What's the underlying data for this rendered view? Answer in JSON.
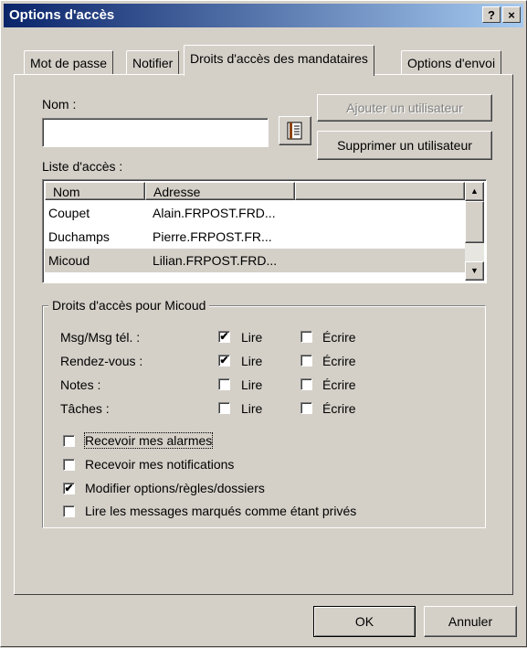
{
  "window": {
    "title": "Options d'accès",
    "help_label": "?",
    "close_label": "×"
  },
  "tabs": [
    "Mot de passe",
    "Notifier",
    "Droits d'accès des mandataires",
    "Options d'envoi"
  ],
  "name_field": {
    "label": "Nom :",
    "value": ""
  },
  "buttons": {
    "add_user": "Ajouter un utilisateur",
    "remove_user": "Supprimer un utilisateur",
    "ok": "OK",
    "cancel": "Annuler"
  },
  "access_list": {
    "label": "Liste d'accès :",
    "columns": [
      "Nom",
      "Adresse"
    ],
    "rows": [
      {
        "name": "Coupet",
        "address": "Alain.FRPOST.FRD..."
      },
      {
        "name": "Duchamps",
        "address": "Pierre.FRPOST.FR..."
      },
      {
        "name": "Micoud",
        "address": "Lilian.FRPOST.FRD..."
      }
    ],
    "selected_index": 2
  },
  "rights_group": {
    "title": "Droits d'accès pour Micoud",
    "rows": [
      {
        "label": "Msg/Msg tél. :",
        "read": true,
        "write": false
      },
      {
        "label": "Rendez-vous :",
        "read": true,
        "write": false
      },
      {
        "label": "Notes :",
        "read": false,
        "write": false
      },
      {
        "label": "Tâches :",
        "read": false,
        "write": false
      }
    ],
    "read_label": "Lire",
    "write_label": "Écrire",
    "options": [
      {
        "label": "Recevoir mes alarmes",
        "checked": false
      },
      {
        "label": "Recevoir mes notifications",
        "checked": false
      },
      {
        "label": "Modifier options/règles/dossiers",
        "checked": true
      },
      {
        "label": "Lire les messages marqués comme étant privés",
        "checked": false
      }
    ]
  }
}
